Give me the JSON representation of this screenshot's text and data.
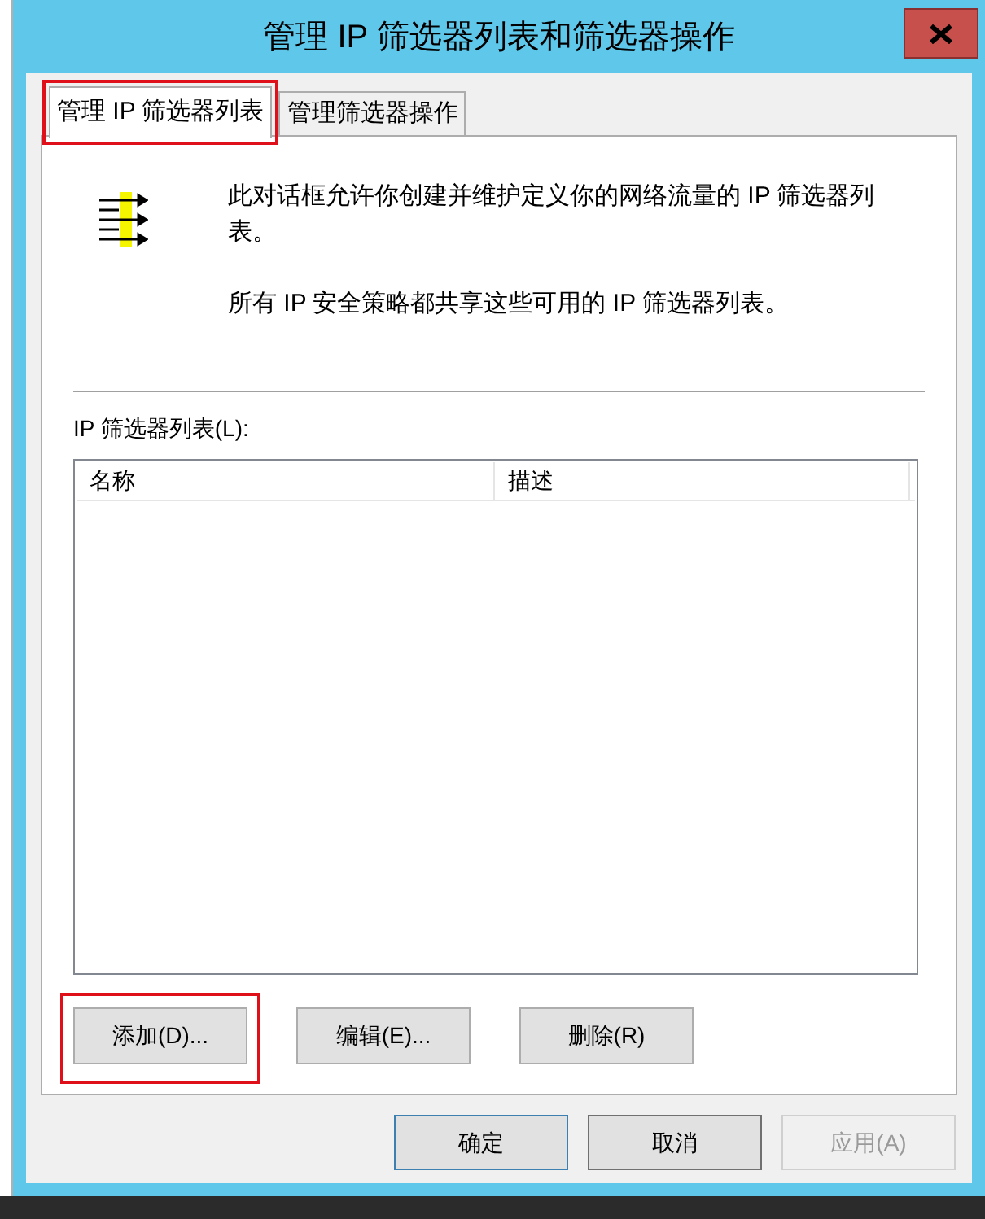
{
  "window": {
    "title": "管理 IP 筛选器列表和筛选器操作"
  },
  "tabs": [
    {
      "label": "管理 IP 筛选器列表",
      "selected": true,
      "highlighted": true
    },
    {
      "label": "管理筛选器操作",
      "selected": false,
      "highlighted": false
    }
  ],
  "intro": [
    "此对话框允许你创建并维护定义你的网络流量的 IP 筛选器列表。",
    "所有 IP 安全策略都共享这些可用的 IP 筛选器列表。"
  ],
  "list": {
    "label": "IP 筛选器列表(L):",
    "columns": [
      "名称",
      "描述"
    ]
  },
  "list_buttons": [
    {
      "label": "添加(D)...",
      "highlighted": true
    },
    {
      "label": "编辑(E)...",
      "highlighted": false
    },
    {
      "label": "删除(R)",
      "highlighted": false
    }
  ],
  "dialog_buttons": [
    {
      "label": "确定",
      "default": true,
      "disabled": false
    },
    {
      "label": "取消",
      "default": false,
      "disabled": false
    },
    {
      "label": "应用(A)",
      "default": false,
      "disabled": true
    }
  ]
}
